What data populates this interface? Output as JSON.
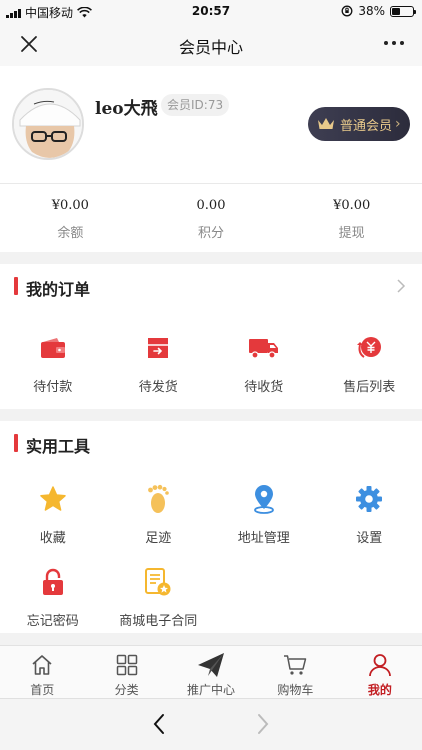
{
  "status_bar": {
    "carrier": "中国移动",
    "time": "20:57",
    "battery": "38%",
    "battery_level": 0.38
  },
  "nav": {
    "title": "会员中心"
  },
  "profile": {
    "username": "leo大飛",
    "member_id": "会员ID:73",
    "level": "普通会员"
  },
  "stats": [
    {
      "value": "¥0.00",
      "label": "余额"
    },
    {
      "value": "0.00",
      "label": "积分"
    },
    {
      "value": "¥0.00",
      "label": "提现"
    }
  ],
  "orders": {
    "title": "我的订单",
    "items": [
      {
        "label": "待付款",
        "icon": "wallet-icon"
      },
      {
        "label": "待发货",
        "icon": "package-out-icon"
      },
      {
        "label": "待收货",
        "icon": "delivery-truck-icon"
      },
      {
        "label": "售后列表",
        "icon": "refund-icon"
      }
    ]
  },
  "tools": {
    "title": "实用工具",
    "items": [
      {
        "label": "收藏",
        "icon": "star-icon"
      },
      {
        "label": "足迹",
        "icon": "footprint-icon"
      },
      {
        "label": "地址管理",
        "icon": "location-pin-icon"
      },
      {
        "label": "设置",
        "icon": "gear-icon"
      },
      {
        "label": "忘记密码",
        "icon": "lock-icon"
      },
      {
        "label": "商城电子合同",
        "icon": "contract-icon"
      }
    ]
  },
  "tabbar": {
    "items": [
      {
        "label": "首页",
        "icon": "home-icon"
      },
      {
        "label": "分类",
        "icon": "category-grid-icon"
      },
      {
        "label": "推广中心",
        "icon": "paper-plane-icon"
      },
      {
        "label": "购物车",
        "icon": "cart-icon"
      },
      {
        "label": "我的",
        "icon": "user-icon"
      }
    ],
    "active": "我的"
  },
  "colors": {
    "accent_red": "#e4393c",
    "active_tab": "#c21e22",
    "star_yellow": "#f5b72f",
    "blue": "#3d8fe0"
  }
}
